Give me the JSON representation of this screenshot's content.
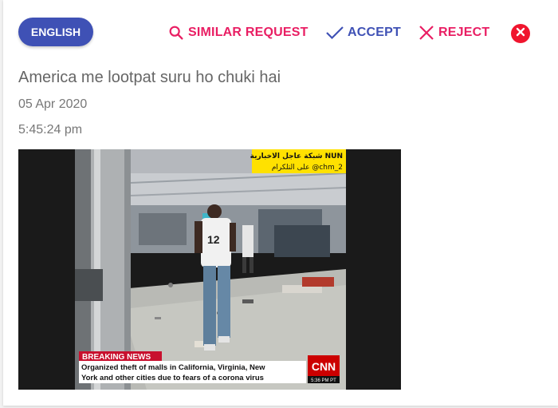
{
  "header": {
    "language_label": "ENGLISH",
    "actions": {
      "similar_label": "SIMILAR REQUEST",
      "accept_label": "ACCEPT",
      "reject_label": "REJECT"
    }
  },
  "post": {
    "title": "America me lootpat suru ho chuki hai",
    "date": "05 Apr 2020",
    "time": "5:45:24 pm"
  },
  "media": {
    "arabic_channel": "شبكة عاجل الاخبارية NUN",
    "arabic_handle": "على التلكرام @chm_2",
    "shirt_number": "12",
    "breaking_label": "BREAKING NEWS",
    "ticker_line1": "Organized theft of malls in California, Virginia, New",
    "ticker_line2": "York and other cities due to fears of a corona virus",
    "network_logo": "CNN",
    "clock": "5:36 PM PT"
  },
  "colors": {
    "primary": "#3f51b5",
    "accent": "#e91e63",
    "close": "#f0152e",
    "muted_text": "#666666"
  },
  "icons": {
    "similar": "search-icon",
    "accept": "check-icon",
    "reject": "x-icon",
    "close": "close-circle-icon"
  }
}
